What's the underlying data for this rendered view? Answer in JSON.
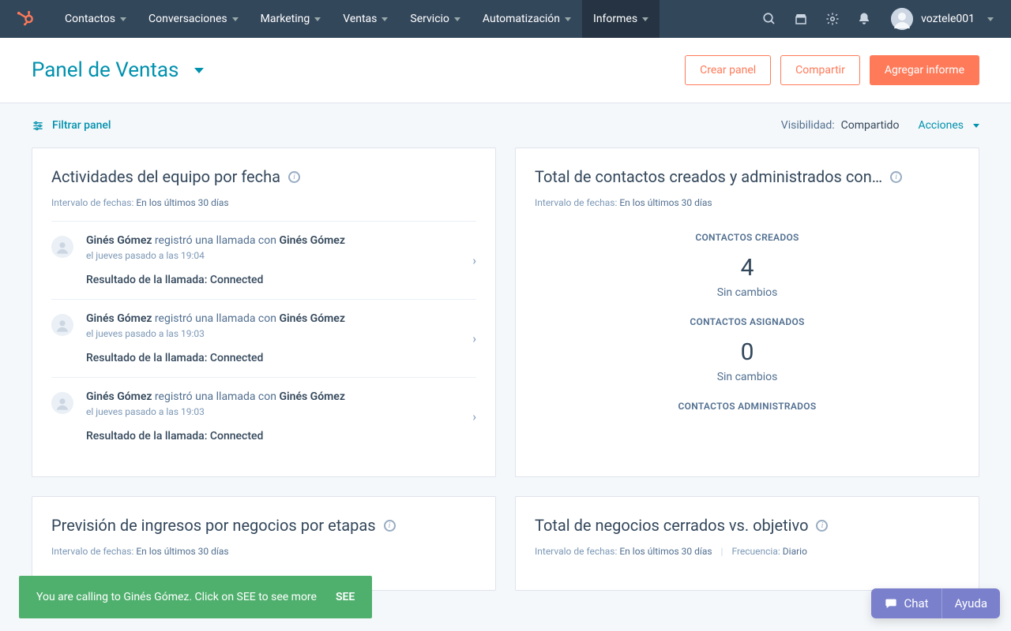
{
  "nav": {
    "items": [
      {
        "label": "Contactos"
      },
      {
        "label": "Conversaciones"
      },
      {
        "label": "Marketing"
      },
      {
        "label": "Ventas"
      },
      {
        "label": "Servicio"
      },
      {
        "label": "Automatización"
      },
      {
        "label": "Informes",
        "active": true
      }
    ],
    "account_name": "voztele001"
  },
  "header": {
    "title": "Panel de Ventas",
    "btn_create": "Crear panel",
    "btn_share": "Compartir",
    "btn_add": "Agregar informe"
  },
  "filter": {
    "filter_label": "Filtrar panel",
    "visibility_label": "Visibilidad:",
    "visibility_value": "Compartido",
    "actions_label": "Acciones"
  },
  "cards": {
    "activities": {
      "title": "Actividades del equipo por fecha",
      "range_label": "Intervalo de fechas:",
      "range_value": "En los últimos 30 días",
      "items": [
        {
          "actor": "Ginés Gómez",
          "verb": " registró una llamada con ",
          "target": "Ginés Gómez",
          "time": "el jueves pasado a las 19:04",
          "result": "Resultado de la llamada: Connected"
        },
        {
          "actor": "Ginés Gómez",
          "verb": " registró una llamada con ",
          "target": "Ginés Gómez",
          "time": "el jueves pasado a las 19:03",
          "result": "Resultado de la llamada: Connected"
        },
        {
          "actor": "Ginés Gómez",
          "verb": " registró una llamada con ",
          "target": "Ginés Gómez",
          "time": "el jueves pasado a las 19:03",
          "result": "Resultado de la llamada: Connected"
        }
      ]
    },
    "contacts": {
      "title": "Total de contactos creados y administrados con…",
      "range_label": "Intervalo de fechas:",
      "range_value": "En los últimos 30 días",
      "metrics": [
        {
          "label": "CONTACTOS CREADOS",
          "value": "4",
          "delta": "Sin cambios"
        },
        {
          "label": "CONTACTOS ASIGNADOS",
          "value": "0",
          "delta": "Sin cambios"
        },
        {
          "label": "CONTACTOS ADMINISTRADOS"
        }
      ]
    },
    "forecast": {
      "title": "Previsión de ingresos por negocios por etapas",
      "range_label": "Intervalo de fechas:",
      "range_value": "En los últimos 30 días"
    },
    "deals": {
      "title": "Total de negocios cerrados vs. objetivo",
      "range_label": "Intervalo de fechas:",
      "range_value": "En los últimos 30 días",
      "freq_label": "Frecuencia:",
      "freq_value": "Diario"
    }
  },
  "toast": {
    "text": "You are calling to Ginés Gómez. Click on SEE to see more",
    "action": "SEE"
  },
  "chat": {
    "chat_label": "Chat",
    "help_label": "Ayuda"
  }
}
